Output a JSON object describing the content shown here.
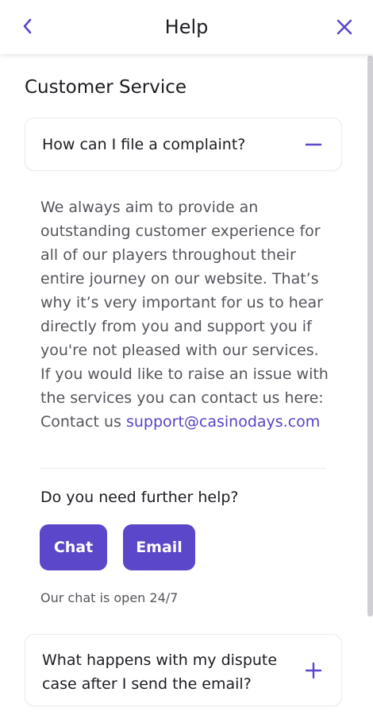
{
  "header": {
    "title": "Help"
  },
  "section": {
    "title": "Customer Service"
  },
  "faq": [
    {
      "question": "How can I file a complaint?",
      "expanded": true,
      "answer_text": "We always aim to provide an outstanding customer experience for all of our players throughout their entire journey on our website. That’s why it’s very important for us to hear directly from you and support you if you're not pleased with our services. If you would like to raise an issue with the services you can contact us here: Contact us",
      "answer_link": "support@casinodays.com"
    },
    {
      "question": "What happens with my dispute case after I send the email?",
      "expanded": false
    }
  ],
  "help": {
    "title": "Do you need further help?",
    "chat_label": "Chat",
    "email_label": "Email",
    "chat_note": "Our chat is open 24/7"
  },
  "colors": {
    "accent": "#5b47c9",
    "link": "#5744c6",
    "text": "#1c1c22",
    "muted_text": "#55555d"
  },
  "icons": {
    "back": "chevron-left-icon",
    "close": "close-icon",
    "collapse": "minus-icon",
    "expand": "plus-icon"
  }
}
